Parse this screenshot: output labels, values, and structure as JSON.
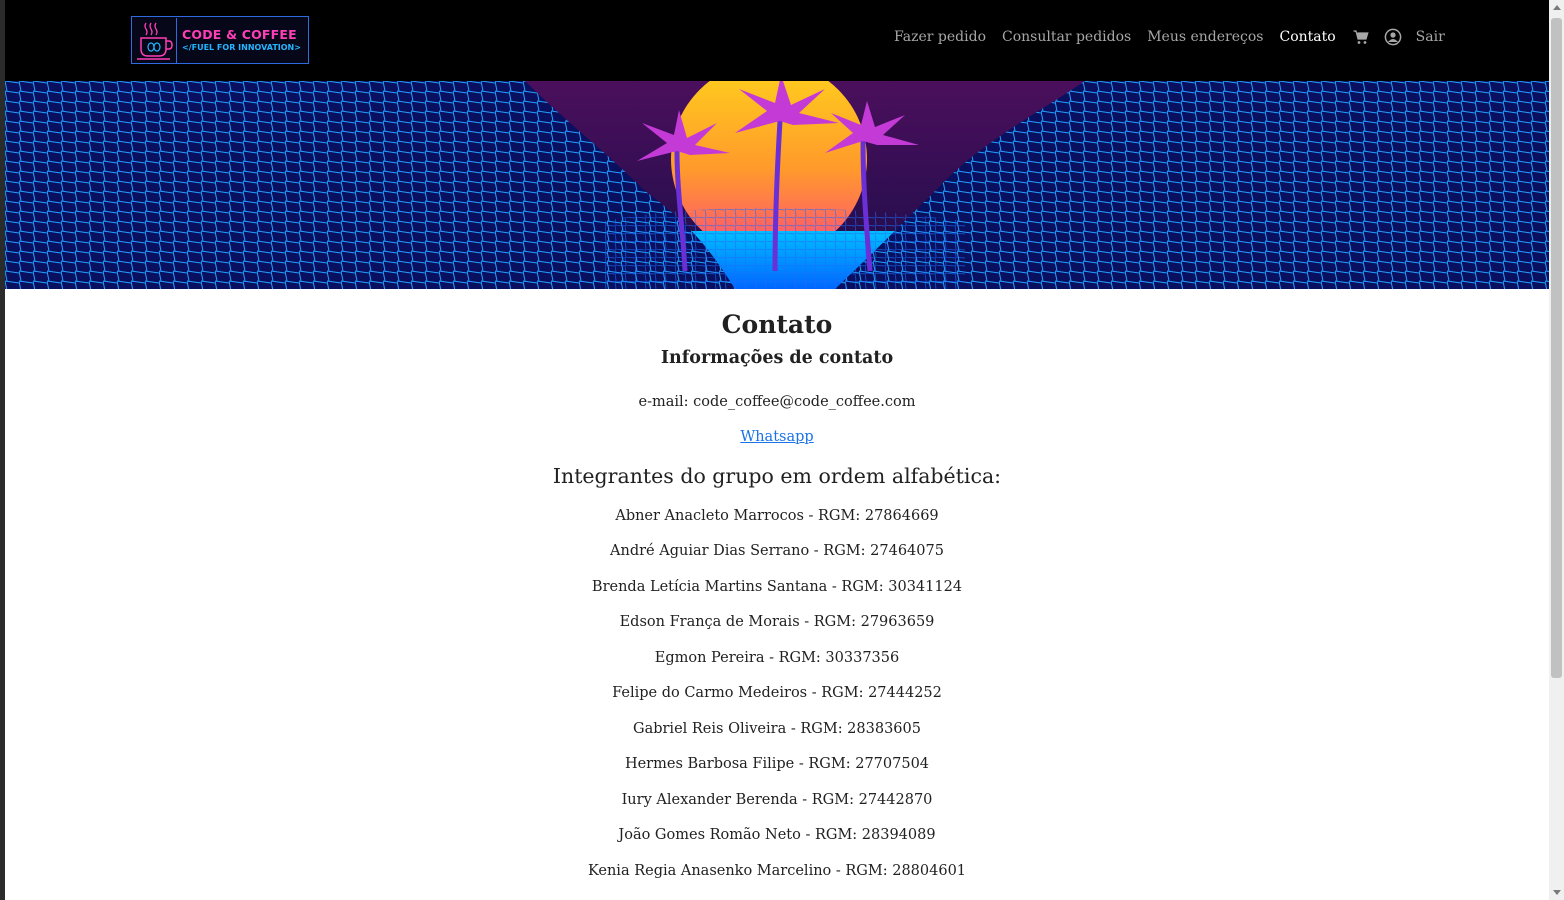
{
  "logo": {
    "line1": "CODE & COFFEE",
    "line2": "</FUEL FOR INNOVATION>"
  },
  "nav": {
    "items": [
      {
        "label": "Fazer pedido",
        "active": false
      },
      {
        "label": "Consultar pedidos",
        "active": false
      },
      {
        "label": "Meus endereços",
        "active": false
      },
      {
        "label": "Contato",
        "active": true
      }
    ],
    "cart_icon": "cart-icon",
    "user_icon": "user-circle-icon",
    "logout": "Sair"
  },
  "content": {
    "title": "Contato",
    "subtitle": "Informações de contato",
    "email": "e-mail: code_coffee@code_coffee.com",
    "whatsapp": "Whatsapp",
    "members_title": "Integrantes do grupo em ordem alfabética:",
    "members": [
      "Abner Anacleto Marrocos - RGM: 27864669",
      "André Aguiar Dias Serrano - RGM: 27464075",
      "Brenda Letícia Martins Santana - RGM: 30341124",
      "Edson França de Morais - RGM: 27963659",
      "Egmon Pereira - RGM: 30337356",
      "Felipe do Carmo Medeiros - RGM: 27444252",
      "Gabriel Reis Oliveira - RGM: 28383605",
      "Hermes Barbosa Filipe - RGM: 27707504",
      "Iury Alexander Berenda - RGM: 27442870",
      "João Gomes Romão Neto - RGM: 28394089",
      "Kenia Regia Anasenko Marcelino - RGM: 28804601"
    ]
  },
  "colors": {
    "navbar": "#000000",
    "nav_link": "#a7a7a7",
    "nav_active": "#ffffff",
    "link": "#1a73e8",
    "logo_pink": "#ff3fb5",
    "logo_blue": "#24b5ff"
  }
}
